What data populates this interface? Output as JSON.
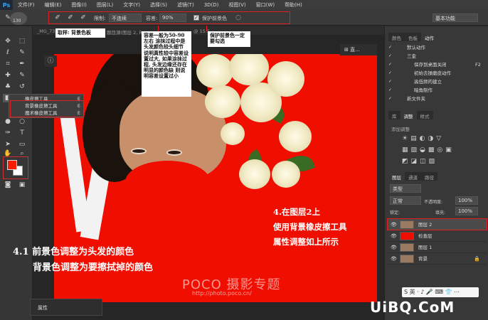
{
  "app": {
    "logo": "Ps"
  },
  "menu": [
    "文件(F)",
    "编辑(E)",
    "图像(I)",
    "图层(L)",
    "文字(Y)",
    "选择(S)",
    "滤镜(T)",
    "3D(D)",
    "视图(V)",
    "窗口(W)",
    "帮助(H)"
  ],
  "options": {
    "brush_size": "130",
    "limits_label": "限制:",
    "limits_value": "不连续",
    "tolerance_label": "容差:",
    "tolerance_value": "90%",
    "protect_label": "保护前景色",
    "protect_checked": true,
    "workspace": "基本功能"
  },
  "doc_tabs": [
    "_MG_73",
    "题目源(图层 2, R",
    "@ 15.5"
  ],
  "tool_flyout": {
    "items": [
      {
        "label": "橡皮擦工具",
        "key": "E"
      },
      {
        "label": "背景橡皮擦工具",
        "key": "E"
      },
      {
        "label": "魔术橡皮擦工具",
        "key": "E"
      }
    ]
  },
  "annotations": {
    "sample": "取样: 背景色板",
    "tolerance_note": "容差一般为50-90左右 涂抹过程中是头发颜色较头细节 说明真性较中容差设置过大, 如果涂抹过程, 头发边缘还存在明显的颜色缺 则说明容差设置过小",
    "protect_note": "保护前景色一定要勾选",
    "step_4_2": [
      "4.在图层2上",
      "使用背景橡皮擦工具",
      "属性调整如上所示"
    ],
    "step_4_1": [
      "4.1 前景色调整为头发的颜色",
      "背景色调整为要擦拭掉的颜色"
    ]
  },
  "watermark": {
    "brand": "POCO 摄影专题",
    "url": "http://photo.poco.cn/"
  },
  "canvas_buttons": {
    "info": "ⓘ",
    "collapse": "⊞ 直..."
  },
  "properties_bar": "属性",
  "panels": {
    "top_tabs": [
      "颜色",
      "色板",
      "动作"
    ],
    "actions": [
      "默认动作",
      "三金",
      "保存到桌面关闭",
      "初始去操磨皮动作",
      "高低频的建立",
      "暗角制作",
      "新文件夹"
    ],
    "action_shortcut": "F2",
    "mid_tabs": [
      "库",
      "调整",
      "样式"
    ],
    "adjust_label": "添加调整",
    "layer_tabs": [
      "图层",
      "通道",
      "路径"
    ],
    "layer_filter": "类型",
    "blend_mode": "正常",
    "opacity_label": "不透明度:",
    "opacity_value": "100%",
    "lock_label": "锁定:",
    "fill_label": "填充:",
    "fill_value": "100%",
    "layers": [
      {
        "name": "图层 2",
        "selected": true,
        "thumb": "#9a7a60"
      },
      {
        "name": "检查层",
        "selected": false,
        "thumb": "#f00e00"
      },
      {
        "name": "图层 1",
        "selected": false,
        "thumb": "#9a7a60"
      },
      {
        "name": "背景",
        "selected": false,
        "thumb": "#9a7a60"
      }
    ]
  },
  "ime_bar": "S 英 · ♪ 🎤 ⌨ 👕 ⋯",
  "site_watermark": "UiBQ.CoM"
}
